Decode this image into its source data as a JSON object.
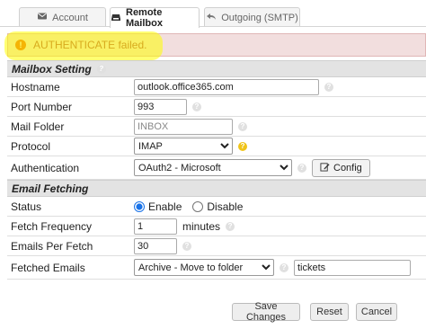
{
  "tabs": {
    "account": "Account",
    "remote_mailbox": "Remote Mailbox",
    "outgoing": "Outgoing (SMTP)"
  },
  "alert": {
    "icon": "!",
    "message": "AUTHENTICATE failed."
  },
  "mailbox_setting": {
    "title": "Mailbox Setting",
    "hostname_label": "Hostname",
    "hostname_value": "outlook.office365.com",
    "port_label": "Port Number",
    "port_value": "993",
    "folder_label": "Mail Folder",
    "folder_placeholder": "INBOX",
    "protocol_label": "Protocol",
    "protocol_value": "IMAP",
    "auth_label": "Authentication",
    "auth_value": "OAuth2 - Microsoft",
    "config_button": "Config"
  },
  "email_fetching": {
    "title": "Email Fetching",
    "status_label": "Status",
    "enable_label": "Enable",
    "disable_label": "Disable",
    "frequency_label": "Fetch Frequency",
    "frequency_value": "1",
    "frequency_unit": "minutes",
    "per_fetch_label": "Emails Per Fetch",
    "per_fetch_value": "30",
    "fetched_label": "Fetched Emails",
    "fetched_action": "Archive - Move to folder",
    "fetched_folder": "tickets"
  },
  "buttons": {
    "save": "Save Changes",
    "reset": "Reset",
    "cancel": "Cancel"
  },
  "colors": {
    "alert_bg": "#f2dede",
    "alert_text": "#a94442",
    "highlight": "#ffff00",
    "section_bg": "#e3e3e3"
  }
}
